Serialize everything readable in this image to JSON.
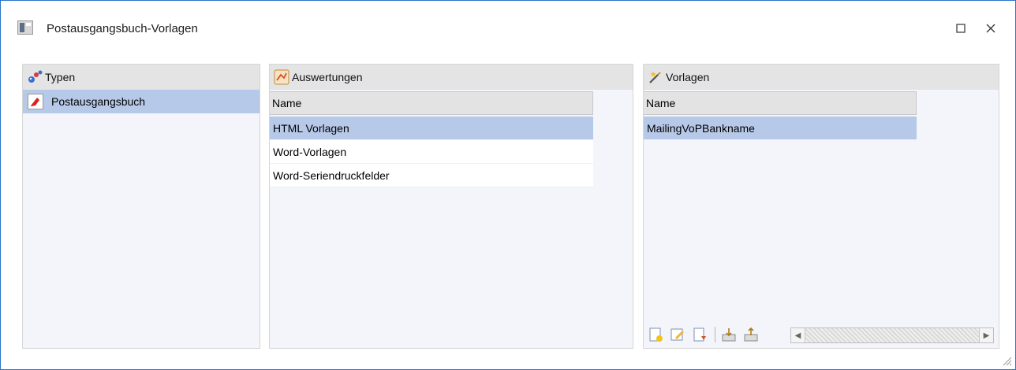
{
  "window": {
    "title": "Postausgangsbuch-Vorlagen"
  },
  "types_panel": {
    "header": "Typen",
    "items": [
      {
        "label": "Postausgangsbuch"
      }
    ]
  },
  "evaluations_panel": {
    "header": "Auswertungen",
    "column_header": "Name",
    "rows": [
      {
        "label": "HTML Vorlagen"
      },
      {
        "label": "Word-Vorlagen"
      },
      {
        "label": "Word-Seriendruckfelder"
      }
    ]
  },
  "templates_panel": {
    "header": "Vorlagen",
    "column_header": "Name",
    "rows": [
      {
        "label": "MailingVoPBankname"
      }
    ],
    "toolbar_icons": [
      "new-icon",
      "edit-icon",
      "delete-icon",
      "import-icon",
      "export-icon"
    ]
  },
  "colors": {
    "selection": "#b7c9e8",
    "panel_bg": "#f3f5fb",
    "header_bg": "#e4e4e4",
    "window_border": "#2b74c7"
  }
}
